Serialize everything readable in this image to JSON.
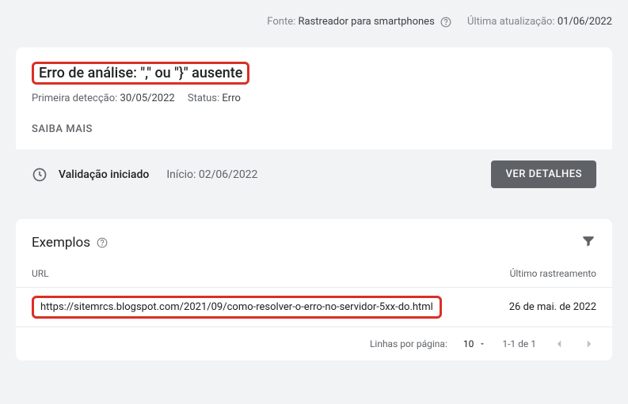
{
  "topBar": {
    "sourceLabel": "Fonte:",
    "sourceValue": "Rastreador para smartphones",
    "updateLabel": "Última atualização:",
    "updateValue": "01/06/2022"
  },
  "issue": {
    "title": "Erro de análise: \",\" ou \"}\" ausente",
    "firstDetectedLabel": "Primeira detecção:",
    "firstDetectedValue": "30/05/2022",
    "statusLabel": "Status:",
    "statusValue": "Erro",
    "learnMore": "SAIBA MAIS"
  },
  "validation": {
    "statusText": "Validação iniciado",
    "startLabel": "Início:",
    "startDate": "02/06/2022",
    "detailsButton": "VER DETALHES"
  },
  "examples": {
    "title": "Exemplos",
    "urlHeader": "URL",
    "lastCrawlHeader": "Último rastreamento",
    "rows": [
      {
        "url": "https://sitemrcs.blogspot.com/2021/09/como-resolver-o-erro-no-servidor-5xx-do.html",
        "lastCrawl": "26 de mai. de 2022"
      }
    ]
  },
  "pagination": {
    "rowsLabel": "Linhas por página:",
    "rowsValue": "10",
    "rangeText": "1-1 de 1"
  }
}
